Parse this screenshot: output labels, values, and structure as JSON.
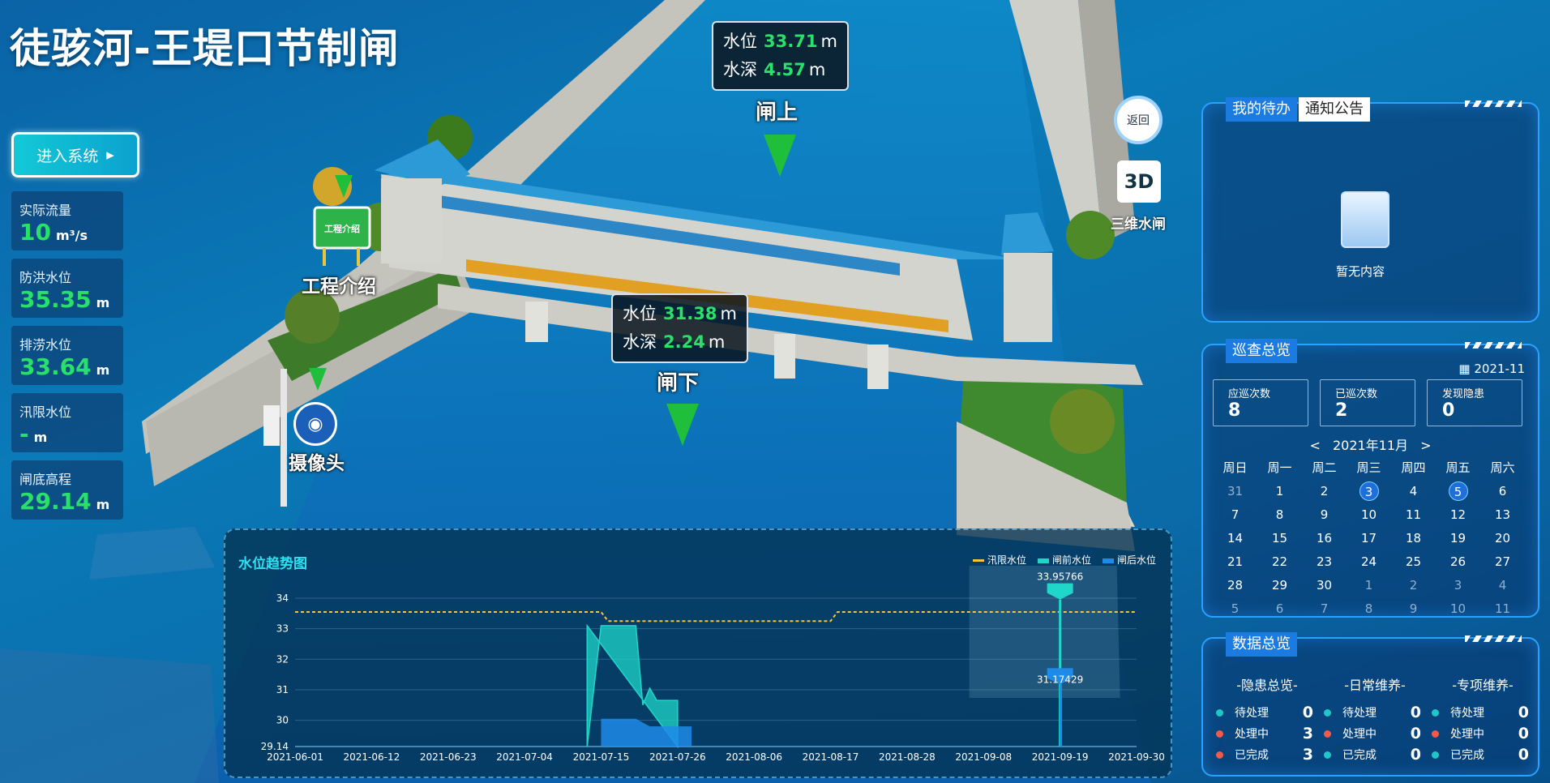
{
  "title": "徒骇河-王堤口节制闸",
  "enter_button": "进入系统",
  "stats": [
    {
      "label": "实际流量",
      "value": "10",
      "unit": "m³/s"
    },
    {
      "label": "防洪水位",
      "value": "35.35",
      "unit": "m"
    },
    {
      "label": "排涝水位",
      "value": "33.64",
      "unit": "m"
    },
    {
      "label": "汛限水位",
      "value": "-",
      "unit": "m"
    },
    {
      "label": "闸底高程",
      "value": "29.14",
      "unit": "m"
    }
  ],
  "gate_up": {
    "name": "闸上",
    "wl_label": "水位",
    "wl": "33.71",
    "wd_label": "水深",
    "wd": "4.57",
    "unit": "m"
  },
  "gate_down": {
    "name": "闸下",
    "wl_label": "水位",
    "wl": "31.38",
    "wd_label": "水深",
    "wd": "2.24",
    "unit": "m"
  },
  "markers": {
    "intro": "工程介绍",
    "intro_sign": "工程介绍",
    "camera": "摄像头",
    "return": "返回",
    "three_d": "三维水闸",
    "three_d_icon": "3D"
  },
  "todo_panel": {
    "tab_active": "我的待办",
    "tab_other": "通知公告",
    "empty": "暂无内容"
  },
  "patrol_panel": {
    "tab": "巡查总览",
    "month": "2021-11",
    "boxes": [
      {
        "label": "应巡次数",
        "value": "8"
      },
      {
        "label": "已巡次数",
        "value": "2"
      },
      {
        "label": "发现隐患",
        "value": "0"
      }
    ],
    "cal_title": "2021年11月",
    "prev": "<",
    "next": ">",
    "weekdays": [
      "周日",
      "周一",
      "周二",
      "周三",
      "周四",
      "周五",
      "周六"
    ],
    "weeks": [
      [
        "31",
        "1",
        "2",
        "3",
        "4",
        "5",
        "6"
      ],
      [
        "7",
        "8",
        "9",
        "10",
        "11",
        "12",
        "13"
      ],
      [
        "14",
        "15",
        "16",
        "17",
        "18",
        "19",
        "20"
      ],
      [
        "21",
        "22",
        "23",
        "24",
        "25",
        "26",
        "27"
      ],
      [
        "28",
        "29",
        "30",
        "1",
        "2",
        "3",
        "4"
      ],
      [
        "5",
        "6",
        "7",
        "8",
        "9",
        "10",
        "11"
      ]
    ],
    "highlighted": [
      "3",
      "5"
    ]
  },
  "data_panel": {
    "tab": "数据总览",
    "groups": [
      {
        "title": "-隐患总览-",
        "rows": [
          {
            "label": "待处理",
            "count": "0",
            "color": "#1fc7c7"
          },
          {
            "label": "处理中",
            "count": "3",
            "color": "#f05a4a"
          },
          {
            "label": "已完成",
            "count": "3",
            "color": "#f05a4a"
          }
        ]
      },
      {
        "title": "-日常维养-",
        "rows": [
          {
            "label": "待处理",
            "count": "0",
            "color": "#1fc7c7"
          },
          {
            "label": "处理中",
            "count": "0",
            "color": "#f05a4a"
          },
          {
            "label": "已完成",
            "count": "0",
            "color": "#1fc7c7"
          }
        ]
      },
      {
        "title": "-专项维养-",
        "rows": [
          {
            "label": "待处理",
            "count": "0",
            "color": "#1fc7c7"
          },
          {
            "label": "处理中",
            "count": "0",
            "color": "#f05a4a"
          },
          {
            "label": "已完成",
            "count": "0",
            "color": "#1fc7c7"
          }
        ]
      }
    ]
  },
  "chart_data": {
    "type": "line",
    "title": "水位趋势图",
    "legend": [
      "汛限水位",
      "闸前水位",
      "闸后水位"
    ],
    "colors": {
      "汛限水位": "#f5c542",
      "闸前水位": "#1fd6c8",
      "闸后水位": "#1e8be8"
    },
    "xticks": [
      "2021-06-01",
      "2021-06-12",
      "2021-06-23",
      "2021-07-04",
      "2021-07-15",
      "2021-07-26",
      "2021-08-06",
      "2021-08-17",
      "2021-08-28",
      "2021-09-08",
      "2021-09-19",
      "2021-09-30"
    ],
    "yticks": [
      "34",
      "33",
      "32",
      "31",
      "30",
      "29.14"
    ],
    "ylim": [
      29.14,
      34
    ],
    "series": [
      {
        "name": "汛限水位",
        "points": [
          [
            "2021-06-01",
            33.55
          ],
          [
            "2021-07-15",
            33.55
          ],
          [
            "2021-07-16",
            33.25
          ],
          [
            "2021-08-17",
            33.25
          ],
          [
            "2021-08-18",
            33.55
          ],
          [
            "2021-09-30",
            33.55
          ]
        ]
      },
      {
        "name": "闸前水位",
        "points": [
          [
            "2021-07-13",
            33.1
          ],
          [
            "2021-07-13",
            29.14
          ],
          [
            "2021-07-15",
            33.1
          ],
          [
            "2021-07-20",
            33.1
          ],
          [
            "2021-07-21",
            30.5
          ],
          [
            "2021-07-22",
            31.05
          ],
          [
            "2021-07-23",
            30.65
          ],
          [
            "2021-07-26",
            30.65
          ],
          [
            "2021-07-26",
            29.14
          ],
          [
            "2021-09-19",
            33.96
          ]
        ]
      },
      {
        "name": "闸后水位",
        "points": [
          [
            "2021-07-15",
            30.05
          ],
          [
            "2021-07-20",
            30.05
          ],
          [
            "2021-07-22",
            29.8
          ],
          [
            "2021-07-28",
            29.8
          ],
          [
            "2021-09-19",
            31.17
          ]
        ]
      }
    ],
    "annotations": [
      {
        "x": "2021-09-19",
        "y": 33.95766,
        "label": "33.95766"
      },
      {
        "x": "2021-09-19",
        "y": 31.17429,
        "label": "31.17429"
      }
    ]
  }
}
